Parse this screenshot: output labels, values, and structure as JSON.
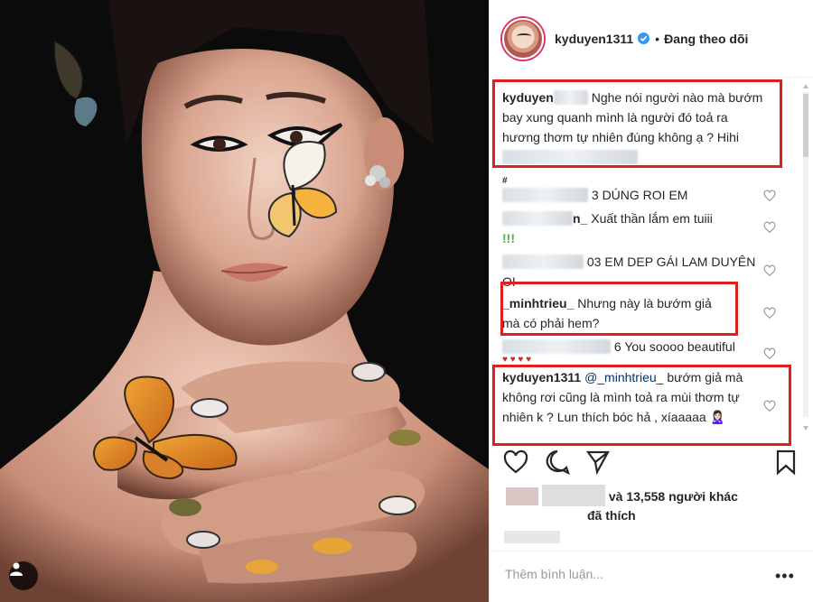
{
  "post": {
    "username": "kyduyen1311",
    "separator": "•",
    "follow_status": "Đang theo dõi"
  },
  "comments": [
    {
      "user": "kyduyen",
      "text": "Nghe nói người nào mà bướm bay xung quanh mình là người đó toả ra hương thơm tự nhiên đúng không ạ ? Hihi"
    },
    {
      "text": "3 DÚNG ROI EM"
    },
    {
      "user_suffix": "n_",
      "text": "Xuất thần lắm em tuiii"
    },
    {
      "text": "!!!"
    },
    {
      "user_suffix": "03",
      "text": "EM DEP GÁI LAM DUYÊN OI"
    },
    {
      "user": "_minhtrieu_",
      "text": "Nhưng này là bướm giả mà có phải hem?"
    },
    {
      "user_suffix": "6",
      "text": "You soooo beautiful"
    },
    {
      "user": "kyduyen1311",
      "mention": "@_minhtrieu_",
      "text": "bướm giả mà không rơi cũng là mình toả ra mùi thơm tự nhiên k ? Lun thích bóc hả , xíaaaaa 🙎🏻‍♀️"
    }
  ],
  "likes": {
    "text": "và 13,558 người khác",
    "text2": "đã thích"
  },
  "add_comment_placeholder": "Thêm bình luận...",
  "more_options": "•••",
  "colors": {
    "highlight": "#e0201c",
    "verified": "#3897f0",
    "text": "#262626",
    "muted": "#999999"
  },
  "icons": [
    "user-tag-icon",
    "verified-icon",
    "heart-icon",
    "comment-icon",
    "share-icon",
    "bookmark-icon",
    "more-icon"
  ]
}
